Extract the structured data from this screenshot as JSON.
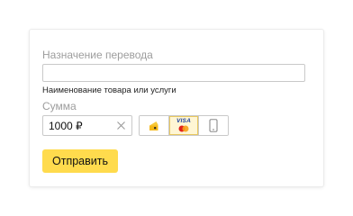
{
  "form": {
    "purpose_label": "Назначение перевода",
    "purpose_value": "",
    "purpose_hint": "Наименование товара или услуги",
    "amount_label": "Сумма",
    "amount_value": "1000 ₽",
    "payment_methods": [
      {
        "name": "yandex-money",
        "icon": "yandex-wallet-icon",
        "selected": false
      },
      {
        "name": "bank-card",
        "label": "VISA",
        "icon": "visa-mastercard-icon",
        "selected": true
      },
      {
        "name": "mobile",
        "icon": "phone-icon",
        "selected": false
      }
    ],
    "submit_label": "Отправить"
  },
  "colors": {
    "accent": "#ffdb4d",
    "selected_bg": "#fff6d4",
    "border": "#c9c9c9",
    "muted_text": "#9d9d9d"
  }
}
